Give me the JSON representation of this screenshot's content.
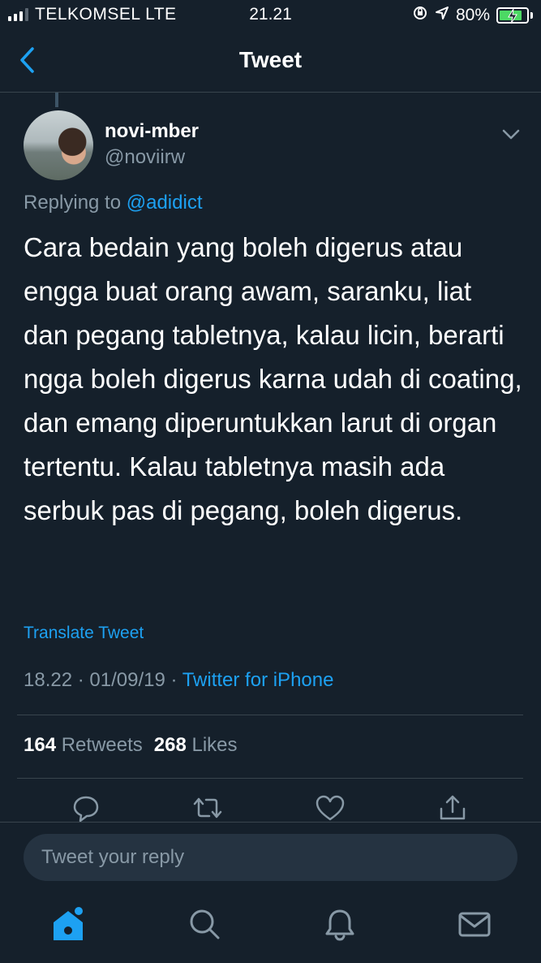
{
  "status_bar": {
    "carrier": "TELKOMSEL LTE",
    "time": "21.21",
    "battery": "80%",
    "battery_level": 0.8,
    "signal_bars": 3
  },
  "header": {
    "title": "Tweet"
  },
  "tweet": {
    "display_name": "novi-mber",
    "handle": "@noviirw",
    "replying_prefix": "Replying to",
    "replying_to": "@adidict",
    "text": "Cara bedain yang boleh digerus atau engga buat orang awam, saranku, liat dan pegang tabletnya, kalau licin, berarti ngga boleh digerus karna udah di coating, dan emang diperuntukkan larut di organ tertentu. Kalau tabletnya masih ada serbuk pas di pegang, boleh digerus.",
    "translate_label": "Translate Tweet",
    "timestamp": "18.22 · 01/09/19 ·",
    "source": "Twitter for iPhone",
    "retweets_count": "164",
    "retweets_label": "Retweets",
    "likes_count": "268",
    "likes_label": "Likes"
  },
  "reply": {
    "placeholder": "Tweet your reply"
  },
  "icons": {
    "back": "chevron-left-icon",
    "more": "chevron-down-icon",
    "reply": "comment-icon",
    "retweet": "retweet-icon",
    "like": "heart-icon",
    "share": "share-icon",
    "home": "home-icon",
    "search": "search-icon",
    "notifications": "bell-icon",
    "messages": "mail-icon"
  },
  "colors": {
    "background": "#15202b",
    "accent": "#1da1f2",
    "muted": "#8899a6",
    "divider": "#38444d"
  }
}
